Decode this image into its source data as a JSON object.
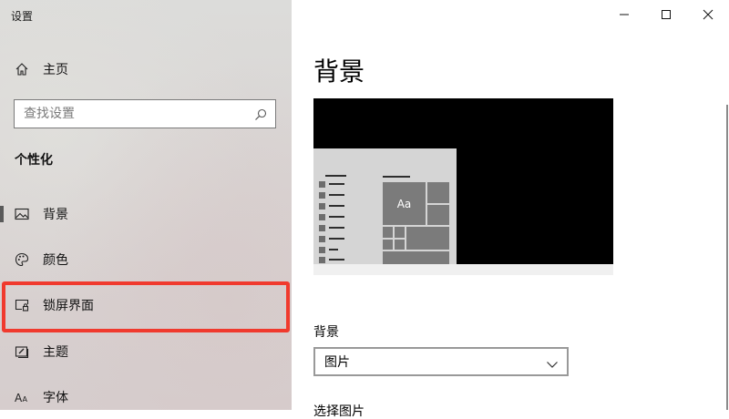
{
  "window": {
    "title": "设置",
    "minimize_icon": "minimize-icon",
    "maximize_icon": "maximize-icon",
    "close_icon": "close-icon"
  },
  "sidebar": {
    "home_label": "主页",
    "home_icon": "home-icon",
    "search": {
      "placeholder": "查找设置",
      "value": "",
      "icon": "search-icon"
    },
    "section_heading": "个性化",
    "items": [
      {
        "label": "背景",
        "icon": "image-icon",
        "selected": true
      },
      {
        "label": "颜色",
        "icon": "palette-icon",
        "selected": false
      },
      {
        "label": "锁屏界面",
        "icon": "lock-screen-icon",
        "selected": false,
        "highlighted": true
      },
      {
        "label": "主题",
        "icon": "theme-icon",
        "selected": false
      },
      {
        "label": "字体",
        "icon": "font-icon",
        "selected": false
      }
    ]
  },
  "main": {
    "page_title": "背景",
    "preview": {
      "tile_text": "Aa"
    },
    "background_field": {
      "label": "背景",
      "selected": "图片",
      "icon": "chevron-down-icon"
    },
    "next_label_partial": "选择图片"
  },
  "colors": {
    "highlight": "#f03a2e",
    "preview_background": "#000000",
    "tile": "#7b7b7b"
  }
}
